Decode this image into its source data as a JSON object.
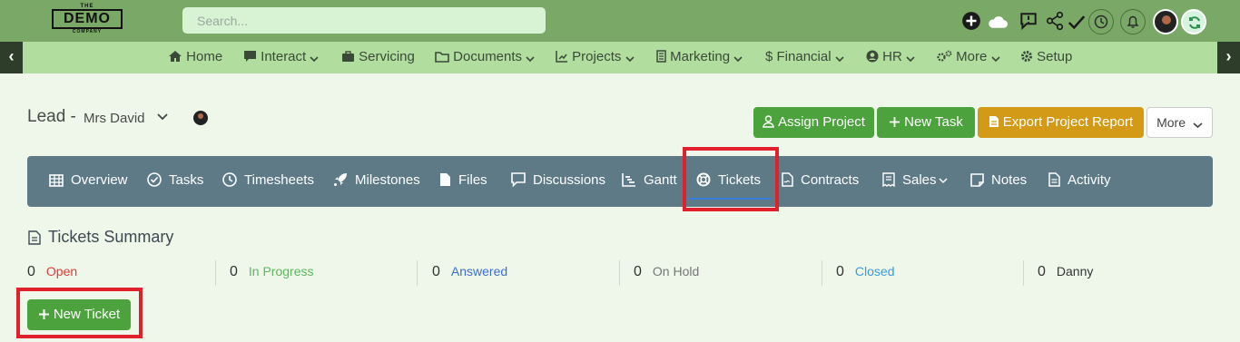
{
  "header": {
    "logo": {
      "top": "THE",
      "main": "DEMO",
      "bottom": "COMPANY"
    },
    "search_placeholder": "Search..."
  },
  "nav": {
    "items": [
      {
        "label": "Home",
        "icon": "home-icon"
      },
      {
        "label": "Interact",
        "icon": "comment-icon",
        "dropdown": true
      },
      {
        "label": "Servicing",
        "icon": "briefcase-icon"
      },
      {
        "label": "Documents",
        "icon": "folder-icon",
        "dropdown": true
      },
      {
        "label": "Projects",
        "icon": "chart-icon",
        "dropdown": true
      },
      {
        "label": "Marketing",
        "icon": "list-icon",
        "dropdown": true
      },
      {
        "label": "Financial",
        "icon": "dollar-icon",
        "dropdown": true
      },
      {
        "label": "HR",
        "icon": "user-circle-icon",
        "dropdown": true
      },
      {
        "label": "More",
        "icon": "gears-icon",
        "dropdown": true
      },
      {
        "label": "Setup",
        "icon": "gear-icon"
      }
    ]
  },
  "page": {
    "lead_prefix": "Lead -",
    "lead_name": "Mrs David",
    "buttons": {
      "assign_project": "Assign Project",
      "new_task": "New Task",
      "export_report": "Export Project Report",
      "more": "More"
    }
  },
  "tabs": [
    {
      "label": "Overview",
      "icon": "grid-icon"
    },
    {
      "label": "Tasks",
      "icon": "check-circle-icon"
    },
    {
      "label": "Timesheets",
      "icon": "clock-icon"
    },
    {
      "label": "Milestones",
      "icon": "rocket-icon"
    },
    {
      "label": "Files",
      "icon": "file-icon"
    },
    {
      "label": "Discussions",
      "icon": "message-icon"
    },
    {
      "label": "Gantt",
      "icon": "chart-icon"
    },
    {
      "label": "Tickets",
      "icon": "life-ring-icon",
      "active": true
    },
    {
      "label": "Contracts",
      "icon": "contract-icon"
    },
    {
      "label": "Sales",
      "icon": "receipt-icon",
      "dropdown": true
    },
    {
      "label": "Notes",
      "icon": "note-icon"
    },
    {
      "label": "Activity",
      "icon": "activity-icon"
    }
  ],
  "summary": {
    "title": "Tickets Summary",
    "stats": [
      {
        "count": "0",
        "label": "Open",
        "color": "#e03b3b"
      },
      {
        "count": "0",
        "label": "In Progress",
        "color": "#5cb85c"
      },
      {
        "count": "0",
        "label": "Answered",
        "color": "#3b6fd4"
      },
      {
        "count": "0",
        "label": "On Hold",
        "color": "#777777"
      },
      {
        "count": "0",
        "label": "Closed",
        "color": "#3b9ae0"
      },
      {
        "count": "0",
        "label": "Danny",
        "color": "#333333"
      }
    ],
    "new_ticket_label": "New Ticket"
  },
  "colors": {
    "topbar": "#7aa866",
    "navbar": "#b1dd9f",
    "tabs": "#5e7a87",
    "green_button": "#4ca23c",
    "orange_button": "#d39a17",
    "highlight": "#e0202a"
  }
}
